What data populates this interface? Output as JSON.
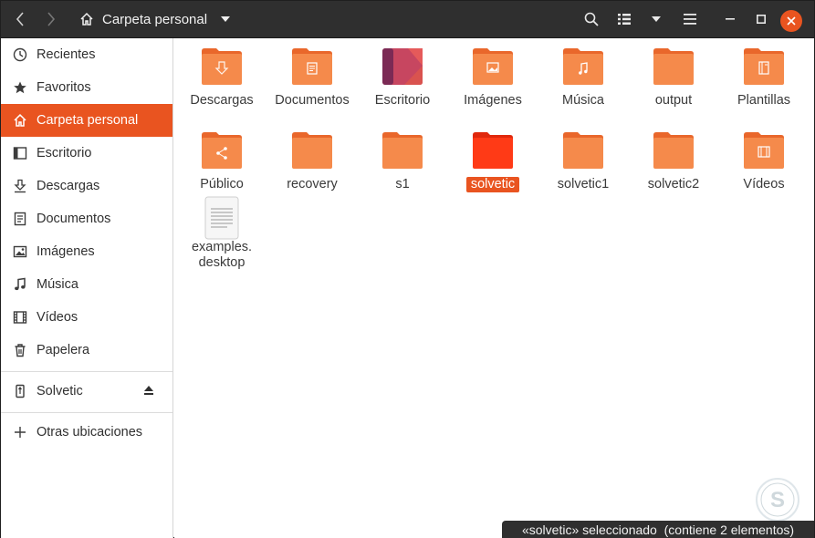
{
  "header": {
    "path_label": "Carpeta personal"
  },
  "sidebar": {
    "items": [
      {
        "label": "Recientes",
        "icon": "clock-icon"
      },
      {
        "label": "Favoritos",
        "icon": "star-icon"
      },
      {
        "label": "Carpeta personal",
        "icon": "home-icon"
      },
      {
        "label": "Escritorio",
        "icon": "desktop-icon"
      },
      {
        "label": "Descargas",
        "icon": "download-icon"
      },
      {
        "label": "Documentos",
        "icon": "document-icon"
      },
      {
        "label": "Imágenes",
        "icon": "image-icon"
      },
      {
        "label": "Música",
        "icon": "music-icon"
      },
      {
        "label": "Vídeos",
        "icon": "film-icon"
      },
      {
        "label": "Papelera",
        "icon": "trash-icon"
      }
    ],
    "device": {
      "label": "Solvetic",
      "icon": "usb-icon"
    },
    "other": {
      "label": "Otras ubicaciones",
      "icon": "plus-icon"
    }
  },
  "files": [
    {
      "label": "Descargas",
      "emblem": "download-icon"
    },
    {
      "label": "Documentos",
      "emblem": "document-icon"
    },
    {
      "label": "Escritorio",
      "emblem": "desktop-icon"
    },
    {
      "label": "Imágenes",
      "emblem": "image-icon"
    },
    {
      "label": "Música",
      "emblem": "music-icon"
    },
    {
      "label": "output",
      "emblem": ""
    },
    {
      "label": "Plantillas",
      "emblem": "template-icon"
    },
    {
      "label": "Público",
      "emblem": "share-icon"
    },
    {
      "label": "recovery",
      "emblem": ""
    },
    {
      "label": "s1",
      "emblem": ""
    },
    {
      "label": "solvetic",
      "emblem": ""
    },
    {
      "label": "solvetic1",
      "emblem": ""
    },
    {
      "label": "solvetic2",
      "emblem": ""
    },
    {
      "label": "Vídeos",
      "emblem": "film-icon"
    },
    {
      "label": "examples.\ndesktop",
      "emblem": "text-file-icon"
    }
  ],
  "status": {
    "text": "«solvetic» seleccionado  (contiene 2 elementos)"
  },
  "colors": {
    "accent": "#e95420",
    "folder": "#f58a4b",
    "selected_folder": "#ff3a16"
  }
}
